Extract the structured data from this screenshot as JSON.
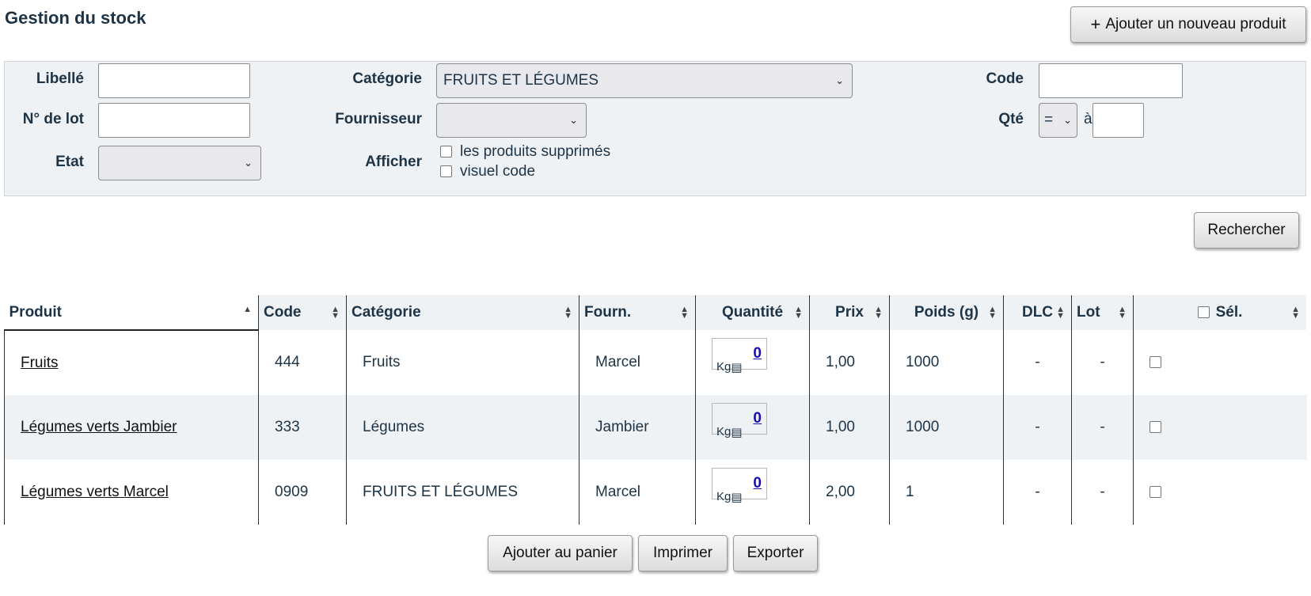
{
  "header": {
    "title": "Gestion du stock",
    "add_product_label": "Ajouter un nouveau produit"
  },
  "filters": {
    "libelle_label": "Libellé",
    "libelle_value": "",
    "lot_label": "N° de lot",
    "lot_value": "",
    "etat_label": "Etat",
    "etat_value": "",
    "categorie_label": "Catégorie",
    "categorie_value": "FRUITS ET LÉGUMES",
    "fournisseur_label": "Fournisseur",
    "fournisseur_value": "",
    "afficher_label": "Afficher",
    "checkbox_deleted": "les produits supprimés",
    "checkbox_visual_code": "visuel code",
    "code_label": "Code",
    "code_value": "",
    "qte_label": "Qté",
    "qte_operator": "=",
    "qte_to": "à",
    "qte_value": ""
  },
  "search_label": "Rechercher",
  "table": {
    "columns": {
      "produit": "Produit",
      "code": "Code",
      "categorie": "Catégorie",
      "fourn": "Fourn.",
      "quantite": "Quantité",
      "prix": "Prix",
      "poids": "Poids (g)",
      "dlc": "DLC",
      "lot": "Lot",
      "sel": "Sél."
    },
    "rows": [
      {
        "produit": "Fruits",
        "code": "444",
        "categorie": "Fruits",
        "fourn": "Marcel",
        "quantite": "0",
        "unit": "Kg",
        "prix": "1,00",
        "poids": "1000",
        "dlc": "-",
        "lot": "-"
      },
      {
        "produit": "Légumes verts Jambier",
        "code": "333",
        "categorie": "Légumes",
        "fourn": "Jambier",
        "quantite": "0",
        "unit": "Kg",
        "prix": "1,00",
        "poids": "1000",
        "dlc": "-",
        "lot": "-"
      },
      {
        "produit": "Légumes verts Marcel",
        "code": "0909",
        "categorie": "FRUITS ET LÉGUMES",
        "fourn": "Marcel",
        "quantite": "0",
        "unit": "Kg",
        "prix": "2,00",
        "poids": "1",
        "dlc": "-",
        "lot": "-"
      }
    ]
  },
  "actions": {
    "cart_label": "Ajouter au panier",
    "print_label": "Imprimer",
    "export_label": "Exporter"
  },
  "icons": {
    "plus": "plus-icon",
    "chevron": "chevron-down-icon",
    "sort": "sort-icon",
    "menu": "menu-icon"
  }
}
